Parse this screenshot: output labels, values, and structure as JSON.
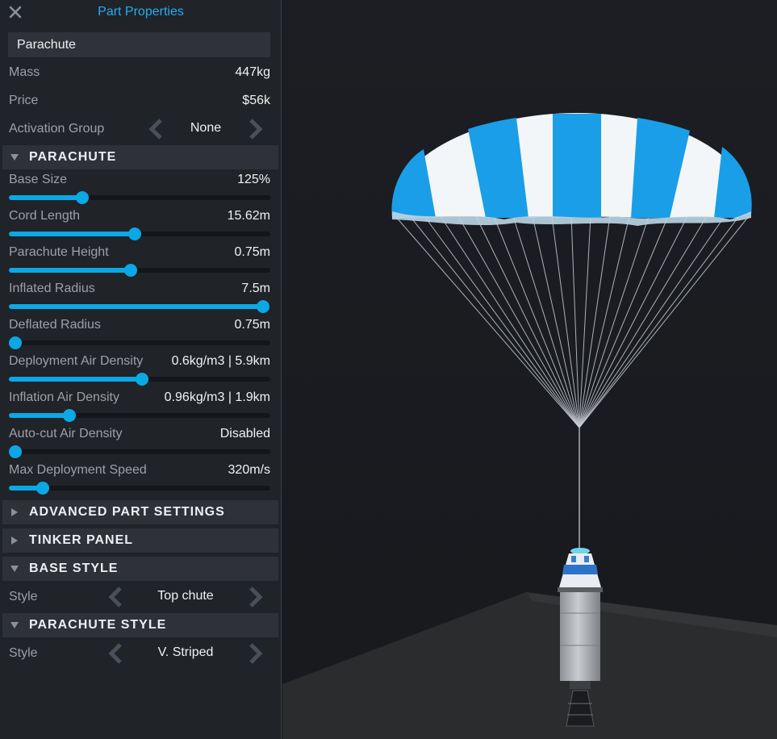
{
  "panel": {
    "title": "Part Properties",
    "part_name": "Parachute",
    "mass": {
      "label": "Mass",
      "value": "447kg"
    },
    "price": {
      "label": "Price",
      "value": "$56k"
    },
    "activation_group": {
      "label": "Activation Group",
      "value": "None"
    }
  },
  "sections": {
    "parachute": "PARACHUTE",
    "advanced": "ADVANCED PART SETTINGS",
    "tinker": "TINKER PANEL",
    "base_style": "BASE STYLE",
    "parachute_style": "PARACHUTE STYLE"
  },
  "sliders": [
    {
      "label": "Base Size",
      "value": "125%",
      "level": 0.28
    },
    {
      "label": "Cord Length",
      "value": "15.62m",
      "level": 0.48
    },
    {
      "label": "Parachute Height",
      "value": "0.75m",
      "level": 0.465
    },
    {
      "label": "Inflated Radius",
      "value": "7.5m",
      "level": 1.0
    },
    {
      "label": "Deflated Radius",
      "value": "0.75m",
      "level": 0.0
    },
    {
      "label": "Deployment Air Density",
      "value": "0.6kg/m3 | 5.9km",
      "level": 0.51
    },
    {
      "label": "Inflation Air Density",
      "value": "0.96kg/m3 | 1.9km",
      "level": 0.23
    },
    {
      "label": "Auto-cut Air Density",
      "value": "Disabled",
      "level": 0.0
    },
    {
      "label": "Max Deployment Speed",
      "value": "320m/s",
      "level": 0.13
    }
  ],
  "base_style": {
    "label": "Style",
    "value": "Top chute"
  },
  "parachute_style": {
    "label": "Style",
    "value": "V. Striped"
  },
  "colors": {
    "accent": "#0ba8e6",
    "title": "#23aef0",
    "canopy_blue": "#1b9ee8",
    "canopy_white": "#f4f7fa"
  },
  "icons": [
    "close-icon",
    "chevron-left-icon",
    "chevron-right-icon",
    "triangle-down-icon",
    "triangle-right-icon"
  ]
}
